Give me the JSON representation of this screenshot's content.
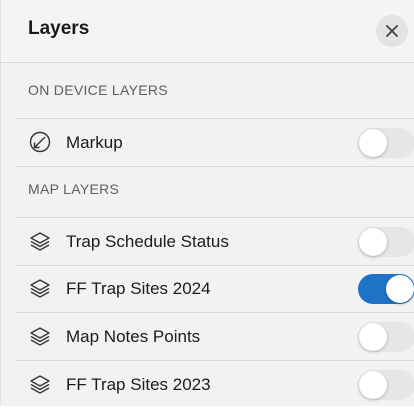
{
  "header": {
    "title": "Layers",
    "close_symbol": "✕"
  },
  "on_device": {
    "section_label": "ON DEVICE LAYERS",
    "items": [
      {
        "label": "Markup",
        "icon": "markup-icon",
        "enabled": false
      }
    ]
  },
  "map_layers": {
    "section_label": "MAP LAYERS",
    "items": [
      {
        "label": "Trap Schedule Status",
        "icon": "layers-icon",
        "enabled": false
      },
      {
        "label": "FF Trap Sites 2024",
        "icon": "layers-icon",
        "enabled": true
      },
      {
        "label": "Map Notes Points",
        "icon": "layers-icon",
        "enabled": false
      },
      {
        "label": "FF Trap Sites 2023",
        "icon": "layers-icon",
        "enabled": false
      }
    ]
  },
  "colors": {
    "toggle_on": "#1f73c6",
    "toggle_off": "#e6e6e6",
    "background": "#f2f2f2"
  }
}
